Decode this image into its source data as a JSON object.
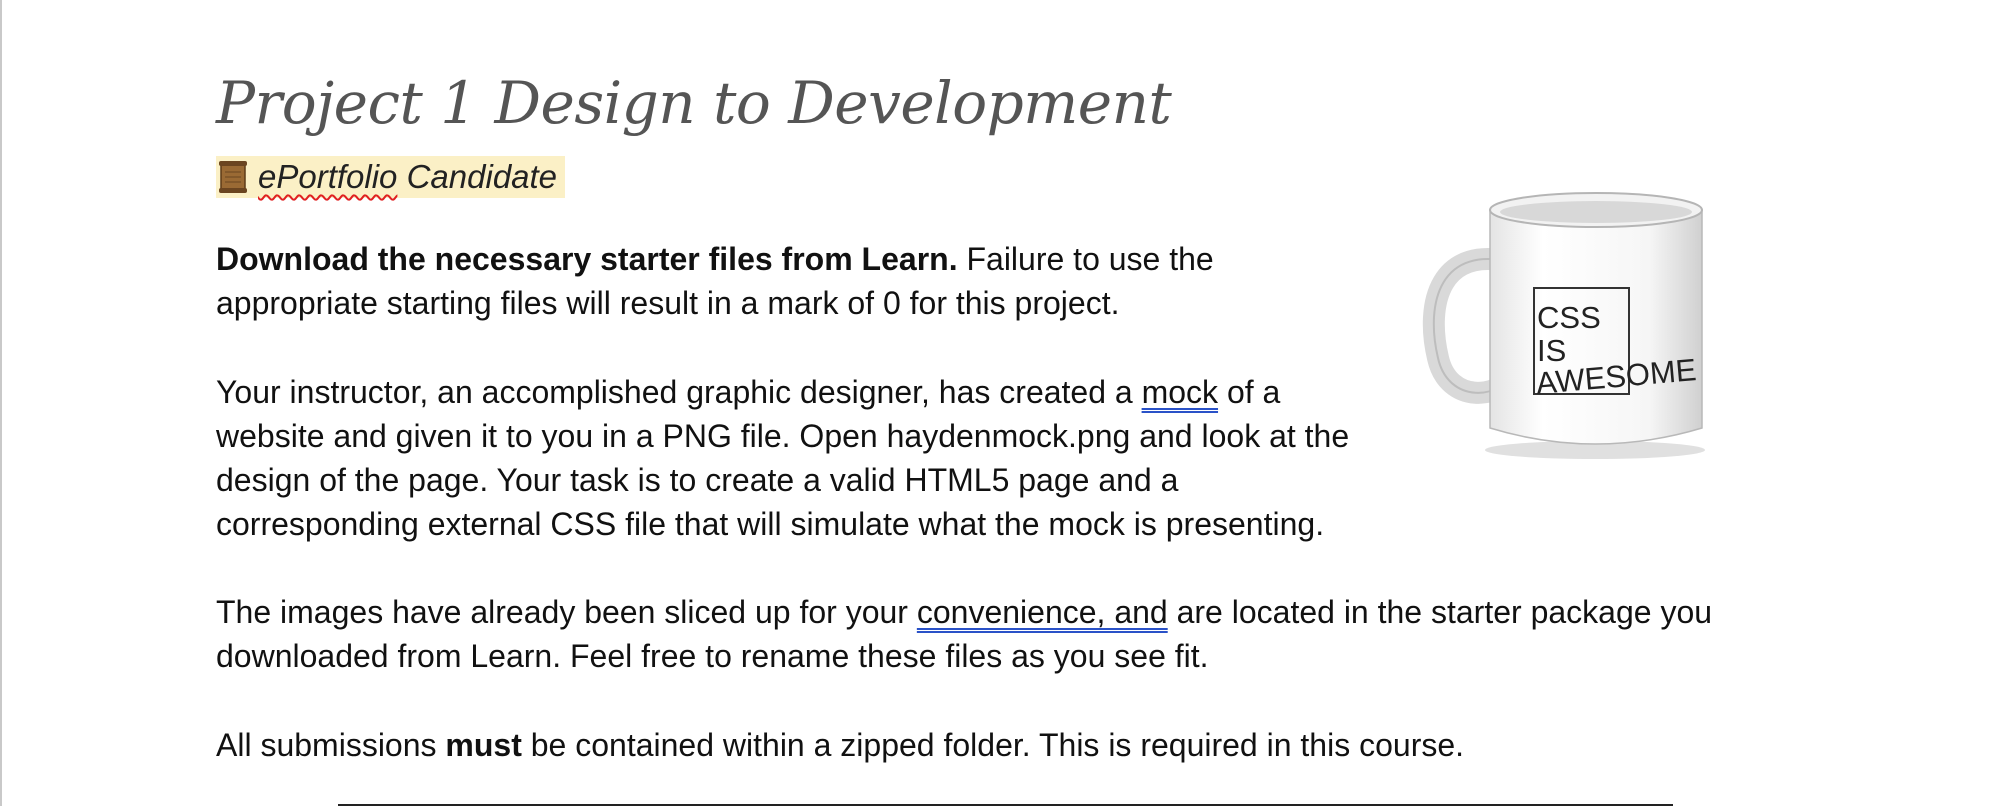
{
  "document": {
    "title": "Project 1 Design to Development",
    "tag": {
      "icon": "scroll-icon",
      "label_misspelled": "ePortfolio",
      "label_rest": " Candidate"
    },
    "paragraph1": {
      "bold": "Download the necessary starter files from Learn.",
      "line1_rest": " Failure to use the",
      "line2": "appropriate starting files will result in a mark of 0 for this project."
    },
    "paragraph2": {
      "line1_before": "Your instructor, an accomplished graphic designer, has created a ",
      "line1_link": "mock",
      "line1_after": " of a",
      "line2": "website and given it to you in a PNG file. Open haydenmock.png and look at the",
      "line3": "design of the page. Your task is to create a valid HTML5 page and a",
      "line4": "corresponding external CSS file that will simulate what the mock is presenting."
    },
    "paragraph3": {
      "line1_before": "The images have already been sliced up for your ",
      "line1_link": "convenience, and",
      "line1_after": " are located in the starter package you",
      "line2": "downloaded from Learn. Feel free to rename these files as you see fit."
    },
    "paragraph4": {
      "before": "All submissions ",
      "bold": "must",
      "after": " be contained within a zipped folder. This is required in this course."
    },
    "mug_image": {
      "line1": "CSS",
      "line2": "IS",
      "line3": "AWESOME"
    }
  },
  "colors": {
    "title": "#555555",
    "tag_background": "#fbf0c6",
    "link_underline": "#2a52c8",
    "spellcheck_underline": "#e02020"
  }
}
